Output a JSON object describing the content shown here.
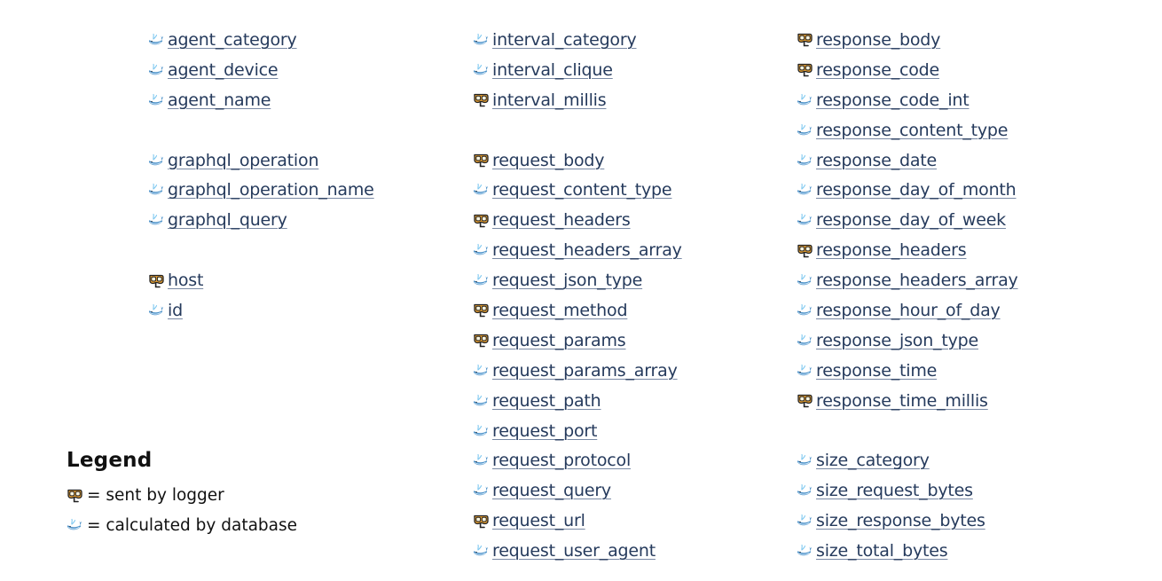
{
  "columns": [
    {
      "items": [
        {
          "label": "agent_category",
          "icon": "whale-icon"
        },
        {
          "label": "agent_device",
          "icon": "whale-icon"
        },
        {
          "label": "agent_name",
          "icon": "whale-icon"
        },
        null,
        {
          "label": "graphql_operation",
          "icon": "whale-icon"
        },
        {
          "label": "graphql_operation_name",
          "icon": "whale-icon"
        },
        {
          "label": "graphql_query",
          "icon": "whale-icon"
        },
        null,
        {
          "label": "host",
          "icon": "diving-mask-icon"
        },
        {
          "label": "id",
          "icon": "whale-icon"
        }
      ]
    },
    {
      "items": [
        {
          "label": "interval_category",
          "icon": "whale-icon"
        },
        {
          "label": "interval_clique",
          "icon": "whale-icon"
        },
        {
          "label": "interval_millis",
          "icon": "diving-mask-icon"
        },
        null,
        {
          "label": "request_body",
          "icon": "diving-mask-icon"
        },
        {
          "label": "request_content_type",
          "icon": "whale-icon"
        },
        {
          "label": "request_headers",
          "icon": "diving-mask-icon"
        },
        {
          "label": "request_headers_array",
          "icon": "whale-icon"
        },
        {
          "label": "request_json_type",
          "icon": "whale-icon"
        },
        {
          "label": "request_method",
          "icon": "diving-mask-icon"
        },
        {
          "label": "request_params",
          "icon": "diving-mask-icon"
        },
        {
          "label": "request_params_array",
          "icon": "whale-icon"
        },
        {
          "label": "request_path",
          "icon": "whale-icon"
        },
        {
          "label": "request_port",
          "icon": "whale-icon"
        },
        {
          "label": "request_protocol",
          "icon": "whale-icon"
        },
        {
          "label": "request_query",
          "icon": "whale-icon"
        },
        {
          "label": "request_url",
          "icon": "diving-mask-icon"
        },
        {
          "label": "request_user_agent",
          "icon": "whale-icon"
        }
      ]
    },
    {
      "items": [
        {
          "label": "response_body",
          "icon": "diving-mask-icon"
        },
        {
          "label": "response_code",
          "icon": "diving-mask-icon"
        },
        {
          "label": "response_code_int",
          "icon": "whale-icon"
        },
        {
          "label": "response_content_type",
          "icon": "whale-icon"
        },
        {
          "label": "response_date",
          "icon": "whale-icon"
        },
        {
          "label": "response_day_of_month",
          "icon": "whale-icon"
        },
        {
          "label": "response_day_of_week",
          "icon": "whale-icon"
        },
        {
          "label": "response_headers",
          "icon": "diving-mask-icon"
        },
        {
          "label": "response_headers_array",
          "icon": "whale-icon"
        },
        {
          "label": "response_hour_of_day",
          "icon": "whale-icon"
        },
        {
          "label": "response_json_type",
          "icon": "whale-icon"
        },
        {
          "label": "response_time",
          "icon": "whale-icon"
        },
        {
          "label": "response_time_millis",
          "icon": "diving-mask-icon"
        },
        null,
        {
          "label": "size_category",
          "icon": "whale-icon"
        },
        {
          "label": "size_request_bytes",
          "icon": "whale-icon"
        },
        {
          "label": "size_response_bytes",
          "icon": "whale-icon"
        },
        {
          "label": "size_total_bytes",
          "icon": "whale-icon"
        }
      ]
    }
  ],
  "legend": {
    "title": "Legend",
    "entries": [
      {
        "icon": "diving-mask-icon",
        "text": "= sent by logger"
      },
      {
        "icon": "whale-icon",
        "text": "= calculated by database"
      }
    ]
  },
  "colors": {
    "link": "#253a5c",
    "whale": "#4a90c8",
    "mask": "#e8a030"
  }
}
